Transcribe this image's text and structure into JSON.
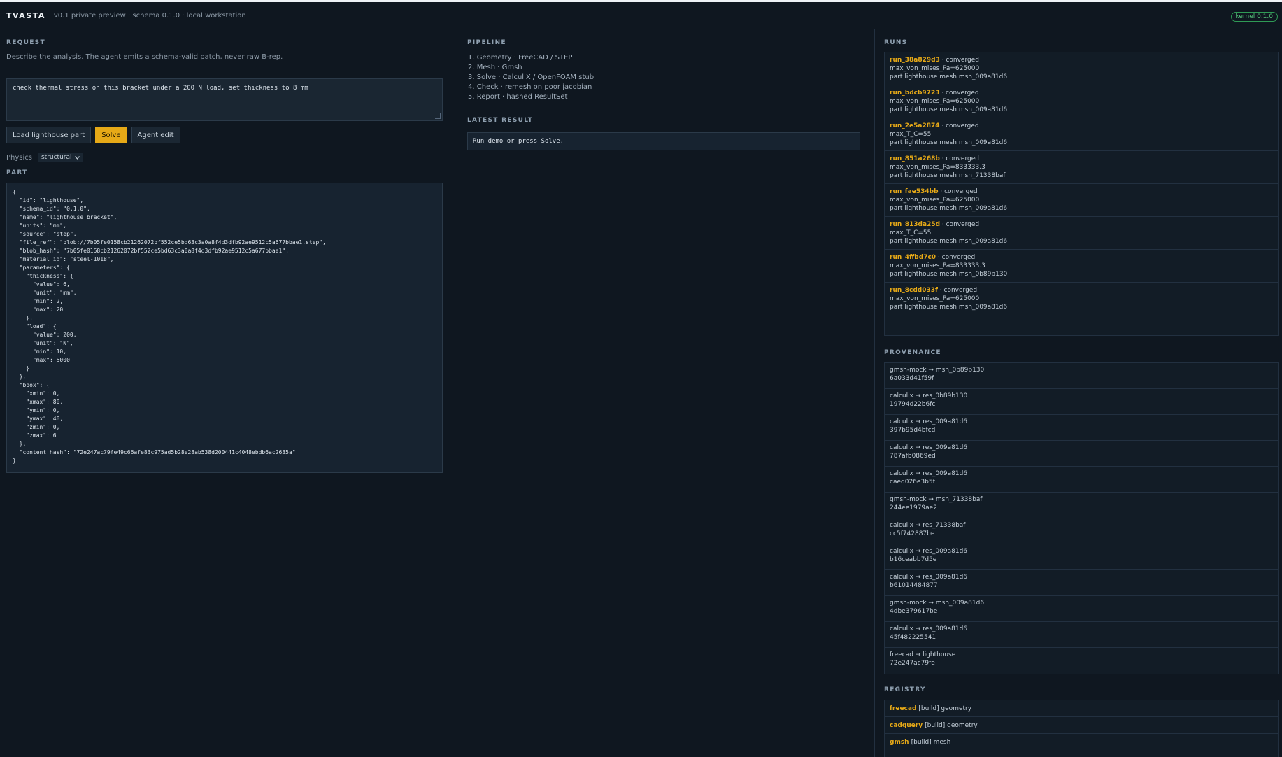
{
  "app": {
    "brand": "TVASTA",
    "subtitle": "v0.1 private preview · schema 0.1.0 · local workstation",
    "kernel_badge": "kernel 0.1.0"
  },
  "request": {
    "title": "REQUEST",
    "hint": "Describe the analysis. The agent emits a schema-valid patch, never raw B-rep.",
    "text": "check thermal stress on this bracket under a 200 N load, set thickness to 8 mm",
    "buttons": {
      "load": "Load lighthouse part",
      "solve": "Solve",
      "agent": "Agent edit"
    },
    "physics_label": "Physics",
    "physics_value": "structural"
  },
  "part": {
    "title": "PART",
    "json": "{\n  \"id\": \"lighthouse\",\n  \"schema_id\": \"0.1.0\",\n  \"name\": \"lighthouse_bracket\",\n  \"units\": \"mm\",\n  \"source\": \"step\",\n  \"file_ref\": \"blob://7b05fe0158cb21262072bf552ce5bd63c3a0a8f4d3dfb92ae9512c5a677bbae1.step\",\n  \"blob_hash\": \"7b05fe0158cb21262072bf552ce5bd63c3a0a8f4d3dfb92ae9512c5a677bbae1\",\n  \"material_id\": \"steel-1018\",\n  \"parameters\": {\n    \"thickness\": {\n      \"value\": 6,\n      \"unit\": \"mm\",\n      \"min\": 2,\n      \"max\": 20\n    },\n    \"load\": {\n      \"value\": 200,\n      \"unit\": \"N\",\n      \"min\": 10,\n      \"max\": 5000\n    }\n  },\n  \"bbox\": {\n    \"xmin\": 0,\n    \"xmax\": 80,\n    \"ymin\": 0,\n    \"ymax\": 40,\n    \"zmin\": 0,\n    \"zmax\": 6\n  },\n  \"content_hash\": \"72e247ac79fe49c66afe83c975ad5b28e28ab538d200441c4048ebdb6ac2635a\"\n}"
  },
  "pipeline": {
    "title": "PIPELINE",
    "steps": [
      "1. Geometry · FreeCAD / STEP",
      "2. Mesh · Gmsh",
      "3. Solve · CalculiX / OpenFOAM stub",
      "4. Check · remesh on poor jacobian",
      "5. Report · hashed ResultSet"
    ]
  },
  "latest": {
    "title": "LATEST RESULT",
    "text": "Run demo or press Solve."
  },
  "runs": {
    "title": "RUNS",
    "items": [
      {
        "id": "run_38a829d3",
        "status": " · converged",
        "metric": "max_von_mises_Pa=625000",
        "mesh": "part lighthouse mesh msh_009a81d6"
      },
      {
        "id": "run_bdcb9723",
        "status": " · converged",
        "metric": "max_von_mises_Pa=625000",
        "mesh": "part lighthouse mesh msh_009a81d6"
      },
      {
        "id": "run_2e5a2874",
        "status": " · converged",
        "metric": "max_T_C=55",
        "mesh": "part lighthouse mesh msh_009a81d6"
      },
      {
        "id": "run_851a268b",
        "status": " · converged",
        "metric": "max_von_mises_Pa=833333.3",
        "mesh": "part lighthouse mesh msh_71338baf"
      },
      {
        "id": "run_fae534bb",
        "status": " · converged",
        "metric": "max_von_mises_Pa=625000",
        "mesh": "part lighthouse mesh msh_009a81d6"
      },
      {
        "id": "run_813da25d",
        "status": " · converged",
        "metric": "max_T_C=55",
        "mesh": "part lighthouse mesh msh_009a81d6"
      },
      {
        "id": "run_4ffbd7c0",
        "status": " · converged",
        "metric": "max_von_mises_Pa=833333.3",
        "mesh": "part lighthouse mesh msh_0b89b130"
      },
      {
        "id": "run_8cdd033f",
        "status": " · converged",
        "metric": "max_von_mises_Pa=625000",
        "mesh": "part lighthouse mesh msh_009a81d6"
      }
    ]
  },
  "provenance": {
    "title": "PROVENANCE",
    "items": [
      {
        "edge": "gmsh-mock → msh_0b89b130",
        "hash": "6a033d41f59f"
      },
      {
        "edge": "calculix → res_0b89b130",
        "hash": "19794d22b6fc"
      },
      {
        "edge": "calculix → res_009a81d6",
        "hash": "397b95d4bfcd"
      },
      {
        "edge": "calculix → res_009a81d6",
        "hash": "787afb0869ed"
      },
      {
        "edge": "calculix → res_009a81d6",
        "hash": "caed026e3b5f"
      },
      {
        "edge": "gmsh-mock → msh_71338baf",
        "hash": "244ee1979ae2"
      },
      {
        "edge": "calculix → res_71338baf",
        "hash": "cc5f742887be"
      },
      {
        "edge": "calculix → res_009a81d6",
        "hash": "b16ceabb7d5e"
      },
      {
        "edge": "calculix → res_009a81d6",
        "hash": "b61014484877"
      },
      {
        "edge": "gmsh-mock → msh_009a81d6",
        "hash": "4dbe379617be"
      },
      {
        "edge": "calculix → res_009a81d6",
        "hash": "45f482225541"
      },
      {
        "edge": "freecad → lighthouse",
        "hash": "72e247ac79fe"
      }
    ]
  },
  "registry": {
    "title": "REGISTRY",
    "items": [
      {
        "name": "freecad",
        "tag": "[build] geometry"
      },
      {
        "name": "cadquery",
        "tag": "[build] geometry"
      },
      {
        "name": "gmsh",
        "tag": "[build] mesh"
      }
    ]
  },
  "colors": {
    "background": "#0f1720",
    "accent": "#e6a917",
    "kernel_green": "#57c77d"
  }
}
